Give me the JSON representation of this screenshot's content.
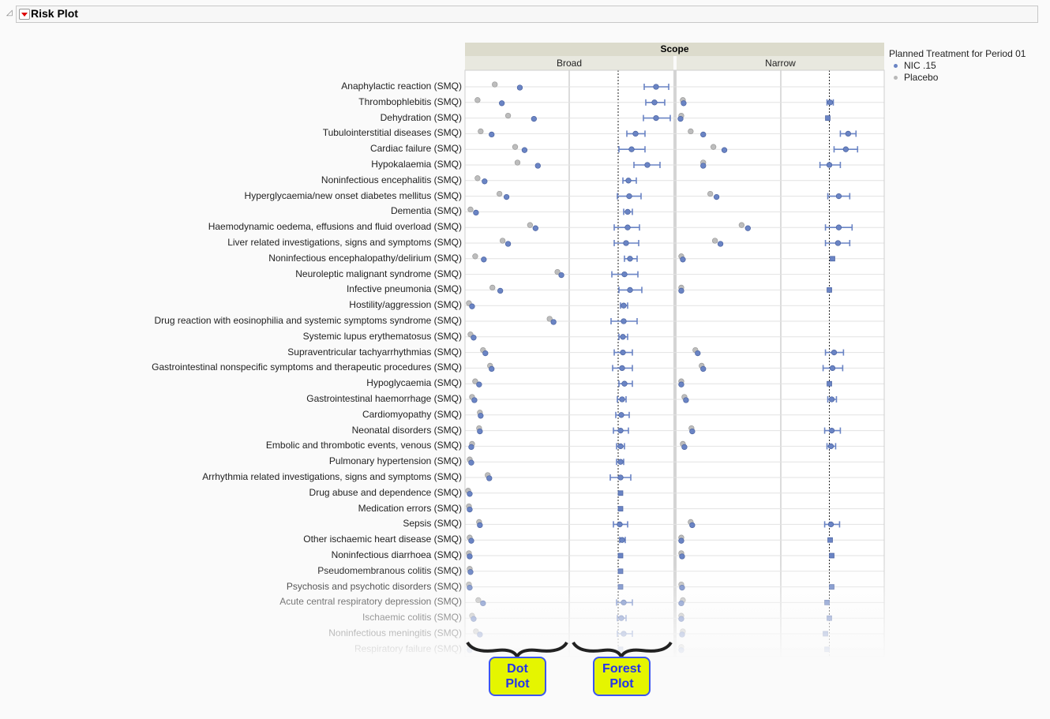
{
  "report": {
    "title": "Risk Plot"
  },
  "chart_data": {
    "type": "scatter",
    "title": "Risk Plot",
    "facet_header": "Scope",
    "facets": [
      "Broad",
      "Narrow"
    ],
    "legend": {
      "title": "Planned Treatment for Period 01",
      "position": "right",
      "entries": [
        {
          "name": "NIC .15",
          "color": "#6a84c4"
        },
        {
          "name": "Placebo",
          "color": "#b8b8b8"
        }
      ]
    },
    "dot_scale_max": 26,
    "forest_scale": [
      -12.2,
      14
    ],
    "columns": [
      "label",
      "broad_placebo",
      "broad_nic",
      "broad_diff",
      "broad_lo",
      "broad_hi",
      "narrow_placebo",
      "narrow_nic",
      "narrow_diff",
      "narrow_lo",
      "narrow_hi"
    ],
    "rows": [
      [
        "Anaphylactic reaction (SMQ)",
        7.4,
        13.8,
        9.6,
        6.6,
        12.8,
        null,
        null,
        null,
        null,
        null
      ],
      [
        "Thrombophlebitis (SMQ)",
        3.0,
        9.2,
        9.2,
        7.0,
        11.8,
        1.4,
        1.6,
        0.2,
        -0.6,
        1.0
      ],
      [
        "Dehydration (SMQ)",
        10.8,
        17.4,
        9.6,
        6.4,
        13.2,
        1.0,
        0.8,
        -0.4,
        null,
        null
      ],
      [
        "Tubulointerstitial diseases (SMQ)",
        3.8,
        6.6,
        4.4,
        2.2,
        6.8,
        3.4,
        6.6,
        4.8,
        2.8,
        6.8
      ],
      [
        "Cardiac failure (SMQ)",
        12.6,
        15.0,
        3.4,
        0.2,
        6.8,
        9.2,
        12.0,
        4.2,
        1.2,
        7.2
      ],
      [
        "Hypokalaemia (SMQ)",
        13.2,
        18.4,
        7.4,
        4.0,
        10.6,
        6.6,
        6.6,
        0.0,
        -2.4,
        2.8
      ],
      [
        "Noninfectious encephalitis (SMQ)",
        3.0,
        4.8,
        2.6,
        1.2,
        4.6,
        null,
        null,
        null,
        null,
        null
      ],
      [
        "Hyperglycaemia/new onset diabetes mellitus (SMQ)",
        8.6,
        10.4,
        2.8,
        -0.2,
        5.8,
        8.4,
        10.0,
        2.4,
        -0.4,
        5.2
      ],
      [
        "Dementia (SMQ)",
        1.2,
        2.6,
        2.4,
        1.4,
        3.6,
        null,
        null,
        null,
        null,
        null
      ],
      [
        "Haemodynamic oedema, effusions and fluid overload (SMQ)",
        16.4,
        17.8,
        2.4,
        -1.0,
        5.4,
        16.4,
        18.0,
        2.4,
        -1.0,
        5.8
      ],
      [
        "Liver related investigations, signs and symptoms (SMQ)",
        9.4,
        10.8,
        2.0,
        -1.0,
        5.2,
        9.6,
        11.0,
        2.2,
        -1.0,
        5.2
      ],
      [
        "Noninfectious encephalopathy/delirium (SMQ)",
        2.4,
        4.6,
        3.0,
        1.6,
        4.8,
        1.0,
        1.4,
        0.8,
        null,
        null
      ],
      [
        "Neuroleptic malignant syndrome (SMQ)",
        23.4,
        24.4,
        1.6,
        -1.6,
        5.0,
        null,
        null,
        null,
        null,
        null
      ],
      [
        "Infective pneumonia (SMQ)",
        6.8,
        8.8,
        3.0,
        0.2,
        6.0,
        1.0,
        1.0,
        0.0,
        null,
        null
      ],
      [
        "Hostility/aggression (SMQ)",
        0.8,
        1.6,
        1.4,
        0.6,
        2.4,
        null,
        null,
        null,
        null,
        null
      ],
      [
        "Drug reaction with eosinophilia and systemic symptoms syndrome (SMQ)",
        21.4,
        22.4,
        1.4,
        -1.8,
        4.8,
        null,
        null,
        null,
        null,
        null
      ],
      [
        "Systemic lupus erythematosus (SMQ)",
        1.2,
        2.0,
        1.2,
        0.2,
        2.4,
        null,
        null,
        null,
        null,
        null
      ],
      [
        "Supraventricular tachyarrhythmias (SMQ)",
        4.4,
        5.0,
        1.2,
        -1.0,
        3.6,
        4.6,
        5.2,
        1.2,
        -1.0,
        3.6
      ],
      [
        "Gastrointestinal nonspecific symptoms and therapeutic procedures (SMQ)",
        6.2,
        6.6,
        1.0,
        -1.4,
        3.6,
        6.2,
        6.6,
        0.8,
        -1.6,
        3.4
      ],
      [
        "Hypoglycaemia (SMQ)",
        2.4,
        3.4,
        1.6,
        0.2,
        3.6,
        1.0,
        1.0,
        0.0,
        null,
        null
      ],
      [
        "Gastrointestinal haemorrhage (SMQ)",
        1.6,
        2.2,
        1.0,
        -0.2,
        2.0,
        1.8,
        2.2,
        0.6,
        -0.4,
        1.8
      ],
      [
        "Cardiomyopathy (SMQ)",
        3.6,
        3.8,
        0.8,
        -0.6,
        2.8,
        null,
        null,
        null,
        null,
        null
      ],
      [
        "Neonatal disorders (SMQ)",
        3.4,
        3.6,
        0.6,
        -1.2,
        2.6,
        3.6,
        3.8,
        0.6,
        -1.2,
        2.8
      ],
      [
        "Embolic and thrombotic events, venous (SMQ)",
        1.6,
        1.4,
        0.6,
        -0.4,
        1.6,
        1.4,
        1.8,
        0.4,
        -0.6,
        1.6
      ],
      [
        "Pulmonary hypertension (SMQ)",
        1.0,
        1.4,
        0.6,
        -0.4,
        1.4,
        null,
        null,
        null,
        null,
        null
      ],
      [
        "Arrhythmia related investigations, signs and symptoms (SMQ)",
        5.6,
        6.0,
        0.6,
        -2.0,
        3.2,
        null,
        null,
        null,
        null,
        null
      ],
      [
        "Drug abuse and dependence (SMQ)",
        0.6,
        1.0,
        0.6,
        null,
        null,
        null,
        null,
        null,
        null,
        null
      ],
      [
        "Medication errors (SMQ)",
        0.8,
        1.0,
        0.6,
        null,
        null,
        null,
        null,
        null,
        null,
        null
      ],
      [
        "Sepsis (SMQ)",
        3.4,
        3.6,
        0.4,
        -1.2,
        2.4,
        3.4,
        3.8,
        0.4,
        -1.2,
        2.6
      ],
      [
        "Other ischaemic heart disease (SMQ)",
        1.0,
        1.4,
        1.0,
        0.4,
        1.8,
        1.0,
        1.0,
        0.2,
        null,
        null
      ],
      [
        "Noninfectious diarrhoea (SMQ)",
        0.8,
        1.0,
        0.6,
        null,
        null,
        1.0,
        1.2,
        0.6,
        null,
        null
      ],
      [
        "Pseudomembranous colitis (SMQ)",
        1.0,
        1.2,
        0.6,
        null,
        null,
        null,
        null,
        null,
        null,
        null
      ],
      [
        "Psychosis and psychotic disorders (SMQ)",
        0.8,
        1.0,
        0.6,
        null,
        null,
        1.0,
        1.2,
        0.6,
        null,
        null
      ],
      [
        "Acute central respiratory depression (SMQ)",
        3.2,
        4.4,
        1.4,
        -0.4,
        3.6,
        1.4,
        1.0,
        -0.6,
        null,
        null
      ],
      [
        "Ischaemic colitis (SMQ)",
        1.6,
        2.0,
        0.8,
        -0.2,
        2.0,
        1.0,
        1.0,
        0.0,
        null,
        null
      ],
      [
        "Noninfectious meningitis (SMQ)",
        2.6,
        3.6,
        1.4,
        -0.2,
        3.6,
        1.4,
        1.2,
        -1.0,
        null,
        null
      ],
      [
        "Respiratory failure (SMQ)",
        1.0,
        1.0,
        0.6,
        null,
        null,
        1.0,
        1.0,
        -0.6,
        null,
        null
      ]
    ]
  },
  "annotations": {
    "dot_plot": [
      "Dot",
      "Plot"
    ],
    "forest_plot": [
      "Forest",
      "Plot"
    ]
  }
}
